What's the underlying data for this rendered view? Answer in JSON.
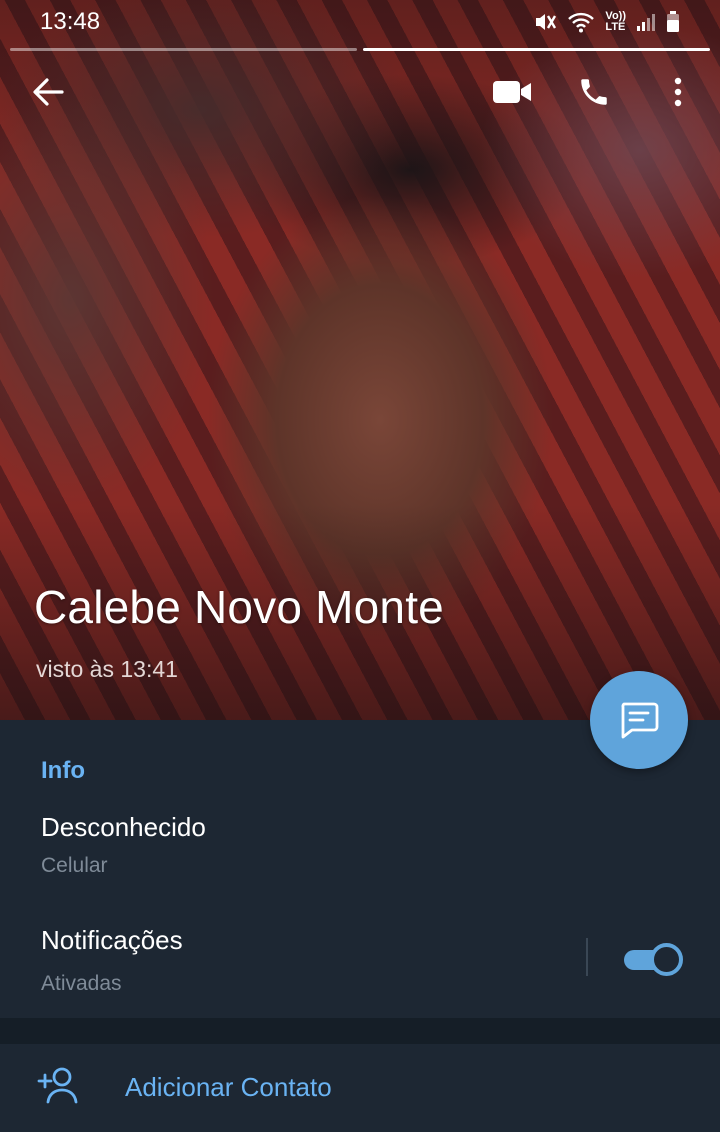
{
  "status_bar": {
    "time": "13:48",
    "icons": [
      "mute-vibrate-icon",
      "wifi-icon",
      "volte-lte-icon",
      "signal-icon",
      "battery-icon"
    ],
    "volte_top": "Vo))",
    "volte_bottom": "LTE"
  },
  "story_progress": {
    "segments": 2,
    "active_index": 1
  },
  "toolbar": {
    "back_icon": "arrow-left-icon",
    "video_icon": "video-camera-icon",
    "call_icon": "phone-icon",
    "more_icon": "more-vertical-icon"
  },
  "profile": {
    "name": "Calebe Novo Monte",
    "last_seen": "visto às 13:41"
  },
  "fab": {
    "icon": "message-icon"
  },
  "info": {
    "section_title": "Info",
    "phone_value": "Desconhecido",
    "phone_label": "Celular",
    "notifications_title": "Notificações",
    "notifications_status": "Ativadas",
    "notifications_enabled": true
  },
  "actions": {
    "add_contact_label": "Adicionar Contato",
    "add_contact_icon": "add-user-icon"
  },
  "colors": {
    "accent": "#5fa4db",
    "link": "#6ab3f3",
    "background": "#1d2733",
    "secondary_text": "#7f8b98"
  }
}
